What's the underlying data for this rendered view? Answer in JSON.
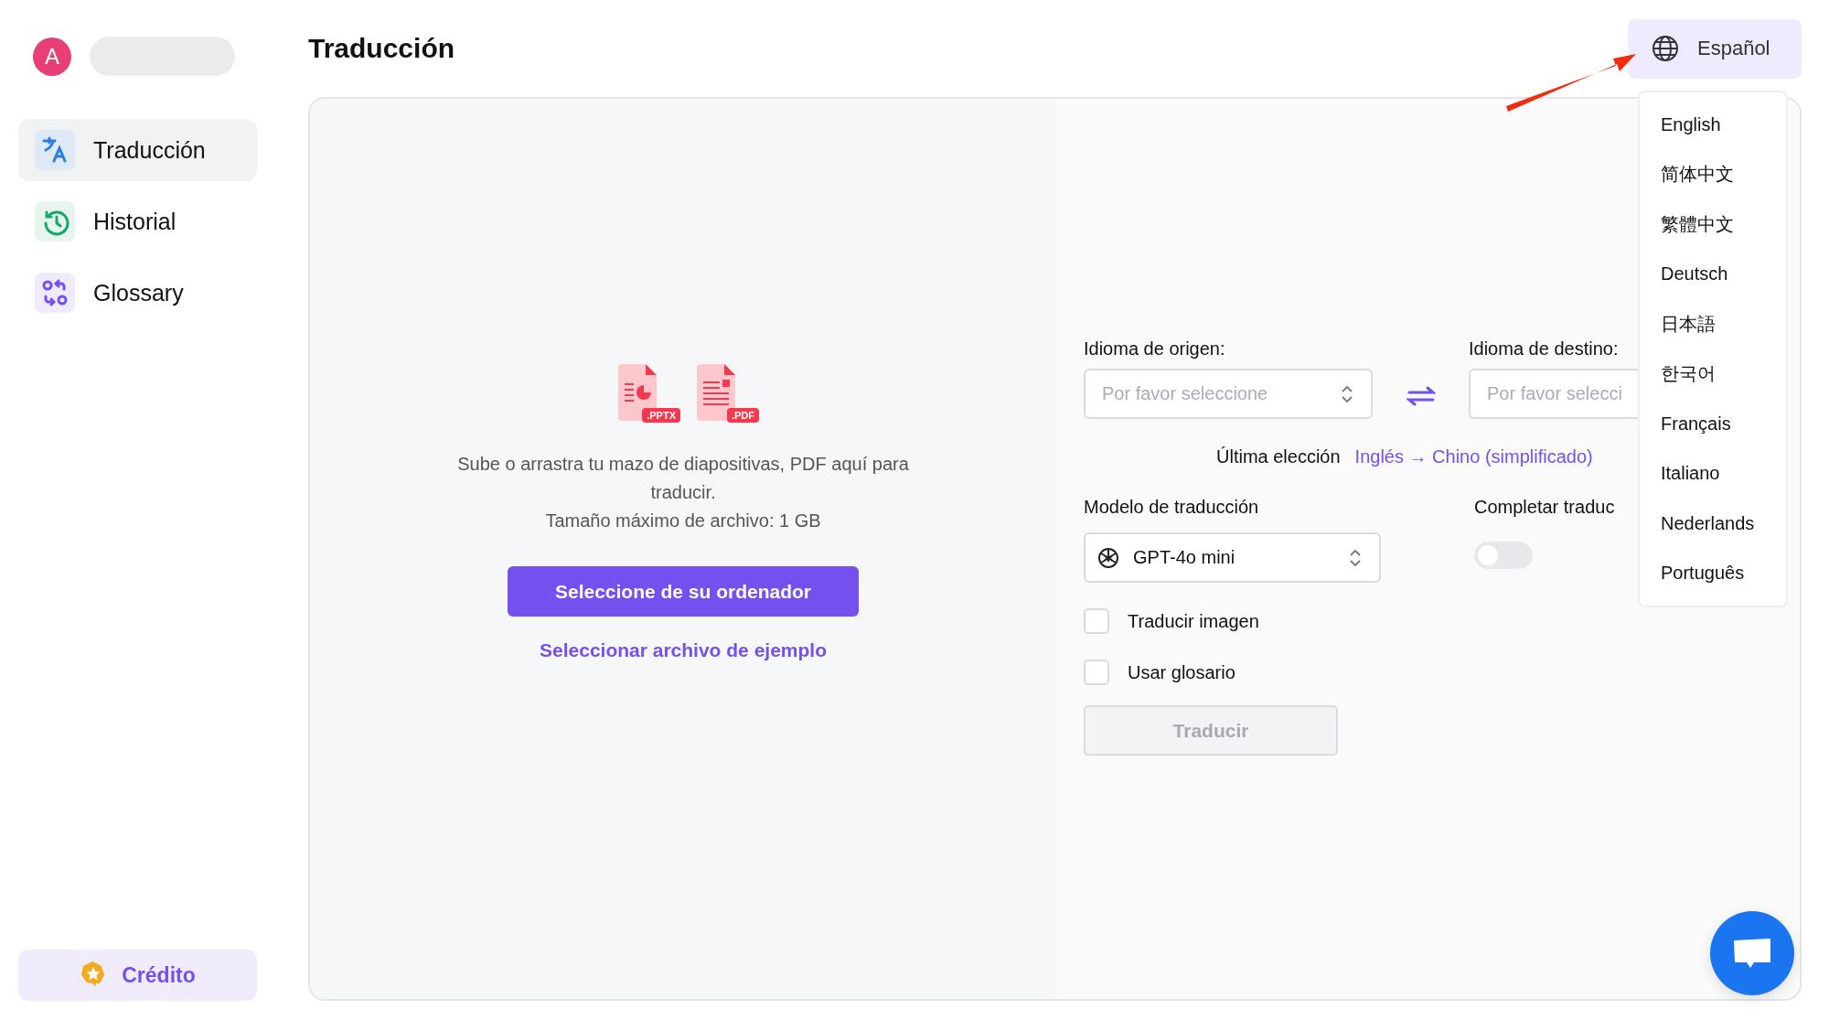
{
  "user": {
    "avatar_letter": "A"
  },
  "sidebar": {
    "items": [
      {
        "kind": "translate",
        "label": "Traducción",
        "selected": true
      },
      {
        "kind": "history",
        "label": "Historial",
        "selected": false
      },
      {
        "kind": "glossary",
        "label": "Glossary",
        "selected": false
      }
    ],
    "credit_button": "Crédito"
  },
  "page_title": "Traducción",
  "language_button": {
    "label": "Español",
    "expanded": true
  },
  "language_menu": [
    "English",
    "简体中文",
    "繁體中文",
    "Deutsch",
    "日本語",
    "한국어",
    "Français",
    "Italiano",
    "Nederlands",
    "Português"
  ],
  "upload": {
    "file_types": [
      {
        "kind": "pptx",
        "label": ".PPTX"
      },
      {
        "kind": "pdf",
        "label": ".PDF"
      }
    ],
    "instructions": "Sube o arrastra tu mazo de diapositivas, PDF aquí para traducir.",
    "max_size": "Tamaño máximo de archivo: 1 GB",
    "select_button": "Seleccione de su ordenador",
    "sample_link": "Seleccionar archivo de ejemplo"
  },
  "form": {
    "source_label": "Idioma de origen:",
    "source_placeholder": "Por favor seleccione",
    "target_label": "Idioma de destino:",
    "target_placeholder": "Por favor selecci",
    "last_choice_label": "Última elección",
    "last_choice_link": "Inglés → Chino (simplificado)",
    "model_label": "Modelo de traducción",
    "model_value": "GPT-4o mini",
    "complete_label": "Completar traduc",
    "complete_toggle_on": false,
    "checkboxes": [
      {
        "label": "Traducir imagen",
        "checked": false
      },
      {
        "label": "Usar glosario",
        "checked": false
      }
    ],
    "translate_button": {
      "label": "Traducir",
      "disabled": true
    }
  }
}
